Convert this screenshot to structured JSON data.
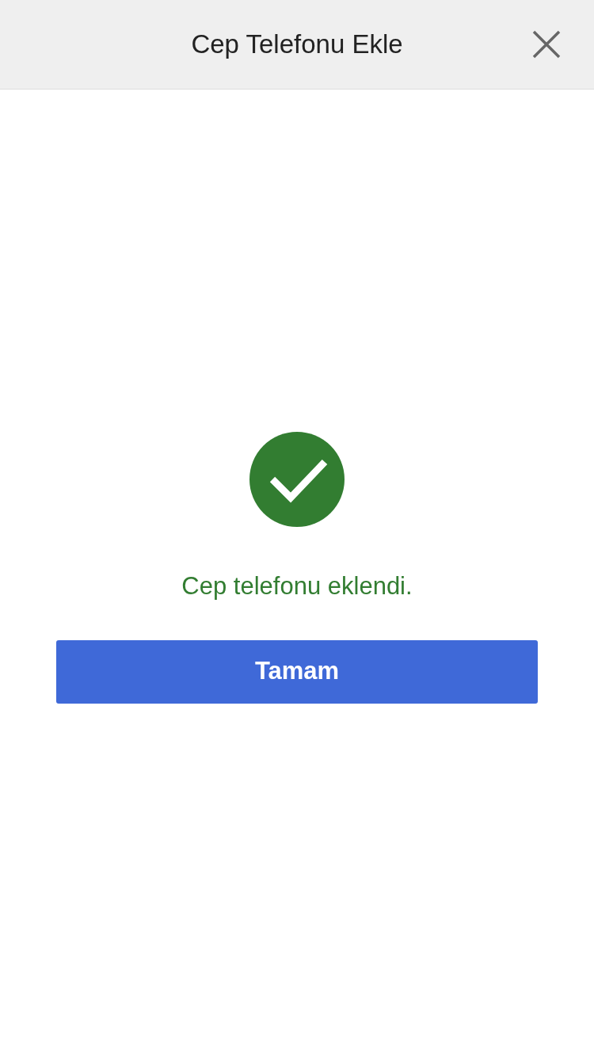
{
  "header": {
    "title": "Cep Telefonu Ekle"
  },
  "message": "Cep telefonu eklendi.",
  "buttons": [
    "Tamam"
  ]
}
